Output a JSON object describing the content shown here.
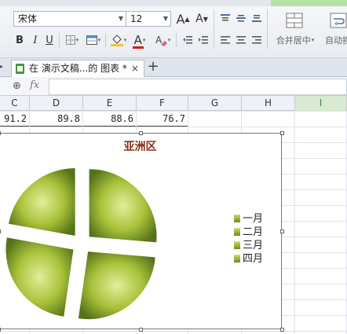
{
  "toolbar": {
    "font_name": "宋体",
    "font_size": "12",
    "grow_font_glyph": "A",
    "shrink_font_glyph": "A",
    "bold": "B",
    "italic": "I",
    "underline": "U",
    "font_color_glyph": "A",
    "merge_center_label": "合并居中",
    "wrap_label_partial": "自动换"
  },
  "tabs": {
    "document_tab": "在 演示文稿...的 图表 *",
    "close_glyph": "×",
    "add_glyph": "+"
  },
  "formula": {
    "fx": "fx",
    "zoom_glyph": "⊕"
  },
  "columns": [
    {
      "label": "C",
      "selected": false
    },
    {
      "label": "D",
      "selected": false
    },
    {
      "label": "E",
      "selected": false
    },
    {
      "label": "F",
      "selected": false
    },
    {
      "label": "G",
      "selected": false
    },
    {
      "label": "H",
      "selected": false
    },
    {
      "label": "I",
      "selected": true
    }
  ],
  "row1": [
    "91.2",
    "89.8",
    "88.6",
    "76.7"
  ],
  "chart": {
    "title": "亚洲区",
    "legend": [
      "一月",
      "二月",
      "三月",
      "四月"
    ],
    "colors": {
      "light": "#d2e27a",
      "dark": "#5f7d14",
      "title": "#8b2e16"
    }
  },
  "chart_data": {
    "type": "pie",
    "title": "亚洲区",
    "categories": [
      "一月",
      "二月",
      "三月",
      "四月"
    ],
    "values": [
      91.2,
      89.8,
      88.6,
      76.7
    ],
    "legend_position": "right",
    "exploded": true
  }
}
